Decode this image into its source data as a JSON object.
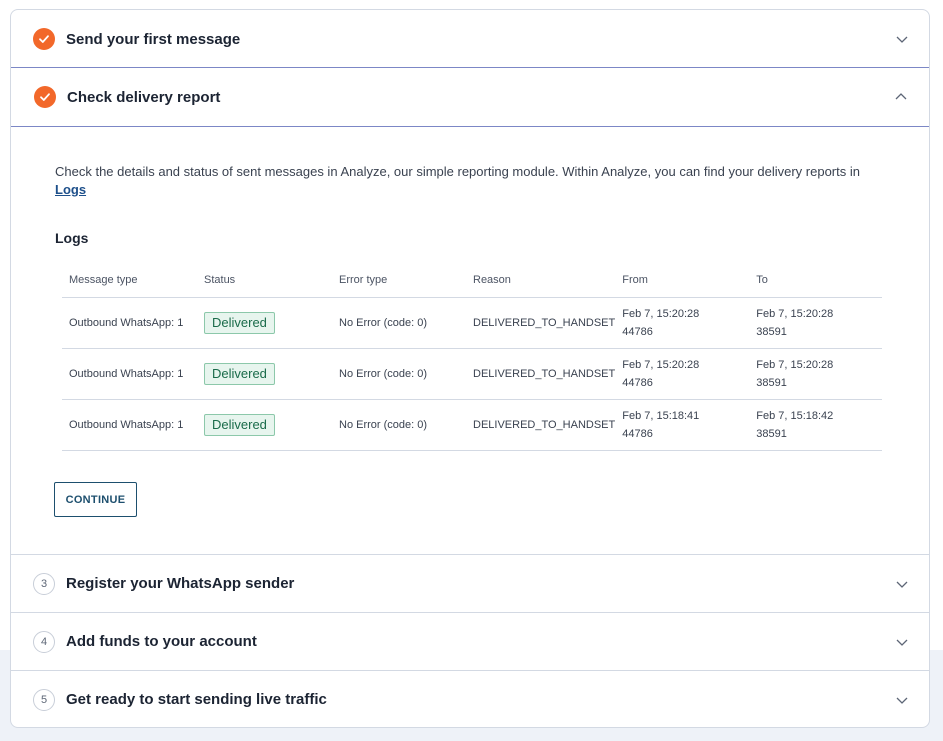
{
  "steps": [
    {
      "number": "1",
      "title": "Send your first message",
      "completed": true,
      "expanded": false
    },
    {
      "number": "2",
      "title": "Check delivery report",
      "completed": true,
      "expanded": true
    },
    {
      "number": "3",
      "title": "Register your WhatsApp sender",
      "completed": false,
      "expanded": false
    },
    {
      "number": "4",
      "title": "Add funds to your account",
      "completed": false,
      "expanded": false
    },
    {
      "number": "5",
      "title": "Get ready to start sending live traffic",
      "completed": false,
      "expanded": false
    }
  ],
  "delivery": {
    "intro_text": "Check the details and status of sent messages in Analyze, our simple reporting module. Within Analyze, you can find your delivery reports in ",
    "logs_link": "Logs",
    "logs_heading": "Logs",
    "columns": [
      "Message type",
      "Status",
      "Error type",
      "Reason",
      "From",
      "To"
    ],
    "rows": [
      {
        "message_type": "Outbound WhatsApp: 1",
        "status": "Delivered",
        "error_type": "No Error (code: 0)",
        "reason": "DELIVERED_TO_HANDSET",
        "from_time": "Feb 7, 15:20:28",
        "from_number": "44786",
        "to_time": "Feb 7, 15:20:28",
        "to_number": "38591"
      },
      {
        "message_type": "Outbound WhatsApp: 1",
        "status": "Delivered",
        "error_type": "No Error (code: 0)",
        "reason": "DELIVERED_TO_HANDSET",
        "from_time": "Feb 7, 15:20:28",
        "from_number": "44786",
        "to_time": "Feb 7, 15:20:28",
        "to_number": "38591"
      },
      {
        "message_type": "Outbound WhatsApp: 1",
        "status": "Delivered",
        "error_type": "No Error (code: 0)",
        "reason": "DELIVERED_TO_HANDSET",
        "from_time": "Feb 7, 15:18:41",
        "from_number": "44786",
        "to_time": "Feb 7, 15:18:42",
        "to_number": "38591"
      }
    ],
    "continue_label": "CONTINUE"
  },
  "colors": {
    "accent_orange": "#f2682a",
    "active_border": "#7c87c6",
    "badge_bg": "#e7f5ee",
    "badge_text": "#1a6b4a",
    "button_text": "#1d4f6e"
  }
}
